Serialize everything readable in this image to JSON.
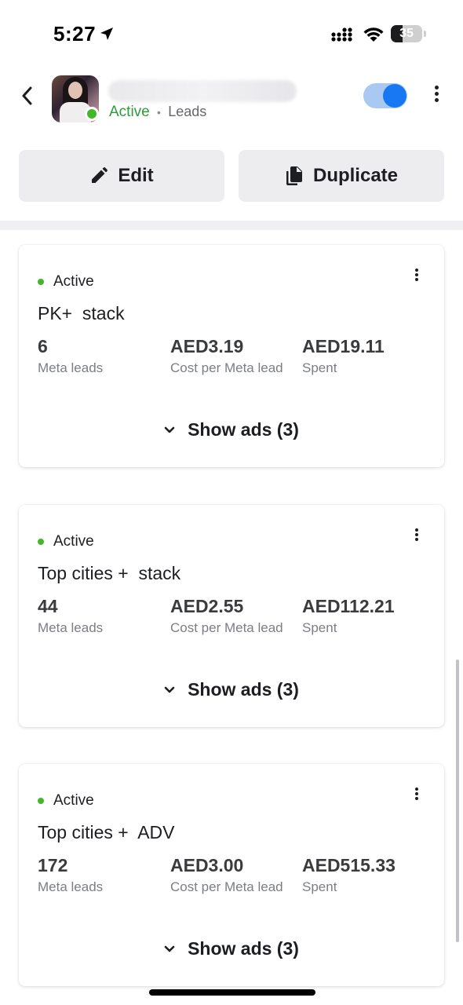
{
  "status_bar": {
    "time": "5:27",
    "battery": "35",
    "icons": [
      "location-arrow-icon",
      "signal-icon",
      "wifi-icon",
      "battery-icon"
    ]
  },
  "header": {
    "status": "Active",
    "separator": "•",
    "objective": "Leads",
    "toggle_on": true,
    "accent": "#1877f2",
    "active_color": "#42b72a"
  },
  "actions": {
    "edit_label": "Edit",
    "duplicate_label": "Duplicate"
  },
  "ad_sets": [
    {
      "status": "Active",
      "name": "PK+  stack",
      "results": "6",
      "results_label": "Meta leads",
      "cost": "AED3.19",
      "cost_label": "Cost per Meta lead",
      "spent": "AED19.11",
      "spent_label": "Spent",
      "show_ads": "Show ads (3)"
    },
    {
      "status": "Active",
      "name": "Top cities +  stack",
      "results": "44",
      "results_label": "Meta leads",
      "cost": "AED2.55",
      "cost_label": "Cost per Meta lead",
      "spent": "AED112.21",
      "spent_label": "Spent",
      "show_ads": "Show ads (3)"
    },
    {
      "status": "Active",
      "name": "Top cities +  ADV",
      "results": "172",
      "results_label": "Meta leads",
      "cost": "AED3.00",
      "cost_label": "Cost per Meta lead",
      "spent": "AED515.33",
      "spent_label": "Spent",
      "show_ads": "Show ads (3)"
    }
  ]
}
